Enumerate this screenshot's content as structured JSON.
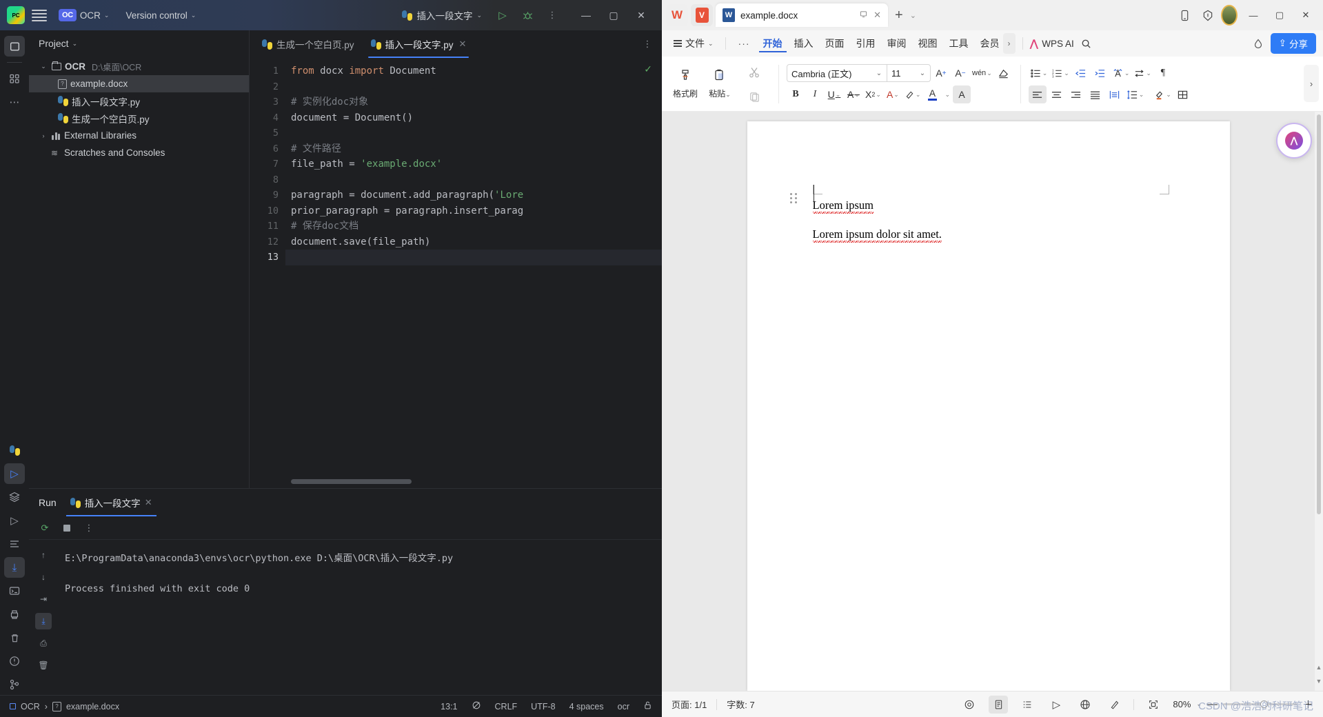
{
  "pycharm": {
    "titlebar": {
      "project_badge": "OC",
      "project_name": "OCR",
      "version_control": "Version control",
      "run_config": "插入一段文字",
      "icons": [
        "pycharm-logo-icon",
        "hamburger-menu-icon",
        "run-icon",
        "debug-icon",
        "more-options-icon",
        "minimize-icon",
        "maximize-icon",
        "close-icon"
      ]
    },
    "project_panel": {
      "title": "Project",
      "tree": [
        {
          "label": "OCR",
          "path": "D:\\桌面\\OCR",
          "icon": "folder-icon",
          "arrow": "v",
          "depth": 0,
          "bold": true,
          "selected": false
        },
        {
          "label": "example.docx",
          "path": "",
          "icon": "unknown-file-icon",
          "arrow": "",
          "depth": 1,
          "bold": false,
          "selected": true
        },
        {
          "label": "插入一段文字.py",
          "path": "",
          "icon": "python-file-icon",
          "arrow": "",
          "depth": 1,
          "bold": false,
          "selected": false
        },
        {
          "label": "生成一个空白页.py",
          "path": "",
          "icon": "python-file-icon",
          "arrow": "",
          "depth": 1,
          "bold": false,
          "selected": false
        },
        {
          "label": "External Libraries",
          "path": "",
          "icon": "library-icon",
          "arrow": ">",
          "depth": 0,
          "bold": false,
          "selected": false
        },
        {
          "label": "Scratches and Consoles",
          "path": "",
          "icon": "scratches-icon",
          "arrow": "",
          "depth": 0,
          "bold": false,
          "selected": false
        }
      ]
    },
    "editor_tabs": [
      {
        "label": "生成一个空白页.py",
        "active": false,
        "closable": false
      },
      {
        "label": "插入一段文字.py",
        "active": true,
        "closable": true
      }
    ],
    "code": {
      "lines": [
        {
          "n": "1",
          "tokens": [
            {
              "t": "from ",
              "c": "kw"
            },
            {
              "t": "docx ",
              "c": "ident"
            },
            {
              "t": "import ",
              "c": "kw"
            },
            {
              "t": "Document",
              "c": "cls"
            }
          ]
        },
        {
          "n": "2",
          "tokens": []
        },
        {
          "n": "3",
          "tokens": [
            {
              "t": "# 实例化doc对象",
              "c": "cmt"
            }
          ]
        },
        {
          "n": "4",
          "tokens": [
            {
              "t": "document ",
              "c": "ident"
            },
            {
              "t": "= ",
              "c": "ident"
            },
            {
              "t": "Document()",
              "c": "fn"
            }
          ]
        },
        {
          "n": "5",
          "tokens": []
        },
        {
          "n": "6",
          "tokens": [
            {
              "t": "# 文件路径",
              "c": "cmt"
            }
          ]
        },
        {
          "n": "7",
          "tokens": [
            {
              "t": "file_path ",
              "c": "ident"
            },
            {
              "t": "= ",
              "c": "ident"
            },
            {
              "t": "'example.docx'",
              "c": "str"
            }
          ]
        },
        {
          "n": "8",
          "tokens": []
        },
        {
          "n": "9",
          "tokens": [
            {
              "t": "paragraph ",
              "c": "ident"
            },
            {
              "t": "= ",
              "c": "ident"
            },
            {
              "t": "document.add_paragraph(",
              "c": "fn"
            },
            {
              "t": "'Lore",
              "c": "str"
            }
          ]
        },
        {
          "n": "10",
          "tokens": [
            {
              "t": "prior_paragraph ",
              "c": "ident"
            },
            {
              "t": "= ",
              "c": "ident"
            },
            {
              "t": "paragraph.insert_parag",
              "c": "fn"
            }
          ]
        },
        {
          "n": "11",
          "tokens": [
            {
              "t": "# 保存doc文档",
              "c": "cmt"
            }
          ]
        },
        {
          "n": "12",
          "tokens": [
            {
              "t": "document.save(file_path)",
              "c": "fn"
            }
          ]
        },
        {
          "n": "13",
          "tokens": [],
          "current": true
        }
      ]
    },
    "run_panel": {
      "title": "Run",
      "tab_label": "插入一段文字",
      "output": "E:\\ProgramData\\anaconda3\\envs\\ocr\\python.exe D:\\桌面\\OCR\\插入一段文字.py\n\nProcess finished with exit code 0"
    },
    "status_bar": {
      "project": "OCR",
      "separator": "›",
      "file": "example.docx",
      "caret": "13:1",
      "line_sep": "CRLF",
      "encoding": "UTF-8",
      "indent": "4 spaces",
      "interpreter": "ocr"
    }
  },
  "wps": {
    "titlebar": {
      "tab_label": "example.docx",
      "tab_icon_letter": "W",
      "app_w": "W",
      "app_pdf": "V",
      "plus": "+"
    },
    "menubar": {
      "file_label": "文件",
      "dots": "···",
      "items": [
        {
          "label": "开始",
          "active": true
        },
        {
          "label": "插入",
          "active": false
        },
        {
          "label": "页面",
          "active": false
        },
        {
          "label": "引用",
          "active": false
        },
        {
          "label": "审阅",
          "active": false
        },
        {
          "label": "视图",
          "active": false
        },
        {
          "label": "工具",
          "active": false
        },
        {
          "label": "会员",
          "active": false
        }
      ],
      "ai_label": "WPS AI",
      "share_label": "分享"
    },
    "ribbon": {
      "format_painter": "格式刷",
      "paste": "粘贴",
      "font_name": "Cambria (正文)",
      "font_size": "11"
    },
    "document": {
      "paragraphs": [
        "Lorem ipsum",
        "Lorem ipsum dolor sit amet."
      ]
    },
    "status_bar": {
      "page": "页面: 1/1",
      "words": "字数: 7",
      "zoom": "80%"
    },
    "watermark": "CSDN @浩浩的科研笔记"
  }
}
